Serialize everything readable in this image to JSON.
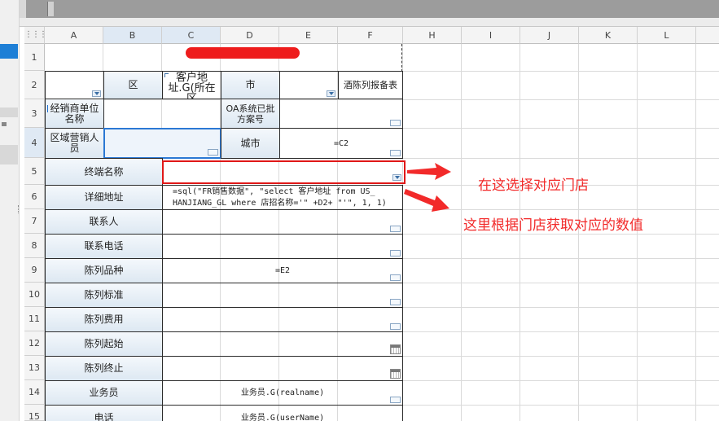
{
  "columns": [
    "A",
    "B",
    "C",
    "D",
    "E",
    "F",
    "H",
    "I",
    "J",
    "K",
    "L"
  ],
  "rows": [
    "1",
    "2",
    "3",
    "4",
    "5",
    "6",
    "7",
    "8",
    "9",
    "10",
    "11",
    "12",
    "13",
    "14",
    "15"
  ],
  "select_all_glyph": "⋮⋮⋮",
  "report": {
    "row2": {
      "district": "区",
      "customer_address": "客户地址.G(所在区",
      "city": "市",
      "report_name": "酒陈列报备表"
    },
    "row3": {
      "dealer_unit": "经销商单位名称",
      "oa_approval": "OA系统已批方案号"
    },
    "row4": {
      "regional_sales": "区域营销人员",
      "city": "城市",
      "city_formula": "=C2"
    },
    "labels": {
      "terminal_name": "终端名称",
      "detail_address": "详细地址",
      "contact": "联系人",
      "contact_phone": "联系电话",
      "display_variety": "陈列品种",
      "display_standard": "陈列标准",
      "display_fee": "陈列费用",
      "display_start": "陈列起始",
      "display_end": "陈列终止",
      "salesman": "业务员",
      "phone": "电话"
    },
    "formulas": {
      "address_line1": "=sql(\"FR销售数据\", \"select 客户地址 from US_",
      "address_line2": "HANJIANG_GL where 店招名称='\" +D2+ \"'\", 1, 1)",
      "variety": "=E2",
      "salesman": "业务员.G(realname)",
      "phone": "业务员.G(userName)"
    }
  },
  "annotations": {
    "select_store": "在这选择对应门店",
    "fetch_values": "这里根据门店获取对应的数值"
  },
  "colors": {
    "annotation_red": "#f22a2a",
    "selection_blue": "#2b78d4",
    "label_fill": "#dde8f2"
  }
}
